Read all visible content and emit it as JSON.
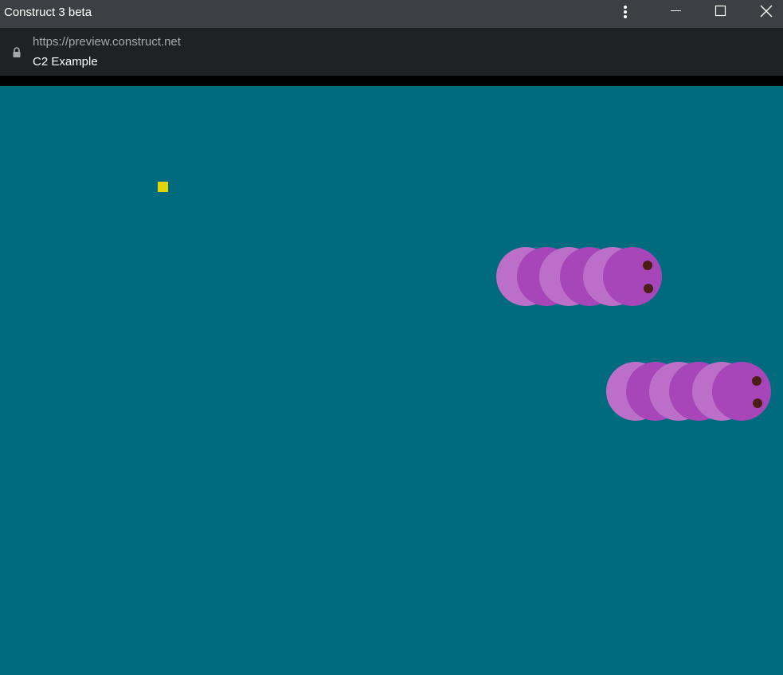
{
  "window": {
    "title": "Construct 3 beta",
    "menu_icon": "vertical-dots-icon",
    "minimize_icon": "minimize-icon",
    "maximize_icon": "maximize-icon",
    "close_icon": "close-icon"
  },
  "address_bar": {
    "url": "https://preview.construct.net",
    "page_title": "C2 Example",
    "lock_icon": "lock-icon"
  },
  "game": {
    "background_color": "#006a7e",
    "food_color": "#e1d40c",
    "worm_light_color": "#bb6fc8",
    "worm_dark_color": "#a646b9",
    "eye_color": "#4a1e14"
  }
}
